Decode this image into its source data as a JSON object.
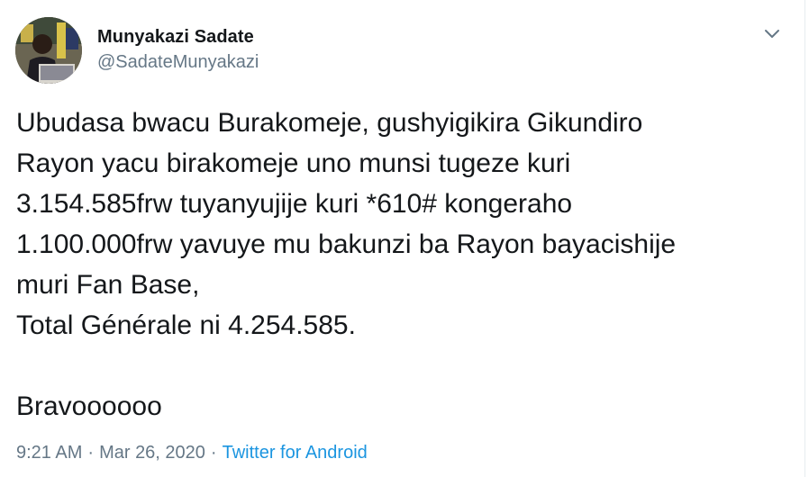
{
  "author": {
    "name": "Munyakazi Sadate",
    "handle": "@SadateMunyakazi"
  },
  "tweet": {
    "text": "Ubudasa bwacu Burakomeje, gushyigikira Gikundiro\nRayon yacu birakomeje uno munsi tugeze kuri\n3.154.585frw tuyanyujije kuri *610# kongeraho\n1.100.000frw yavuye mu bakunzi ba Rayon bayacishije\nmuri Fan Base,\nTotal Générale ni 4.254.585.\n\nBravoooooo",
    "time": "9:21 AM",
    "separator": "·",
    "date": "Mar 26, 2020",
    "source": "Twitter for Android"
  },
  "icons": {
    "menu": "chevron-down-icon",
    "avatar": "profile-photo"
  },
  "colors": {
    "text": "#14171a",
    "secondary": "#657786",
    "link": "#1b95e0"
  }
}
